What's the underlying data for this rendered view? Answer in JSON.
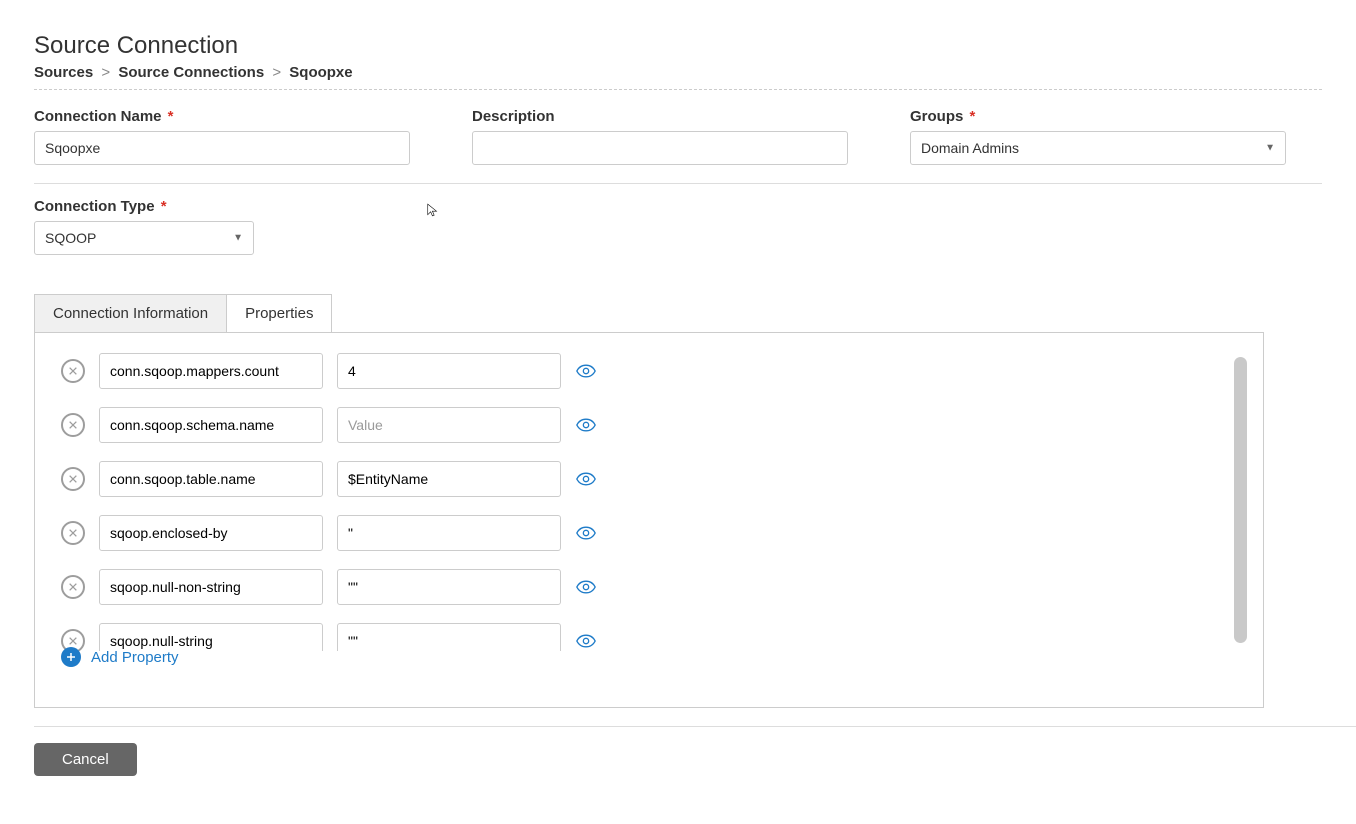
{
  "page_title": "Source Connection",
  "breadcrumb": {
    "items": [
      "Sources",
      "Source Connections",
      "Sqoopxe"
    ]
  },
  "fields": {
    "connection_name_label": "Connection Name",
    "connection_name_value": "Sqoopxe",
    "description_label": "Description",
    "description_value": "",
    "groups_label": "Groups",
    "groups_value": "Domain Admins",
    "connection_type_label": "Connection Type",
    "connection_type_value": "SQOOP"
  },
  "tabs": {
    "conn_info": "Connection Information",
    "properties": "Properties"
  },
  "active_tab": "properties",
  "properties_value_placeholder": "Value",
  "properties": [
    {
      "key": "conn.sqoop.mappers.count",
      "value": "4"
    },
    {
      "key": "conn.sqoop.schema.name",
      "value": ""
    },
    {
      "key": "conn.sqoop.table.name",
      "value": "$EntityName"
    },
    {
      "key": "sqoop.enclosed-by",
      "value": "\""
    },
    {
      "key": "sqoop.null-non-string",
      "value": "\"\""
    },
    {
      "key": "sqoop.null-string",
      "value": "\"\""
    }
  ],
  "add_property_label": "Add Property",
  "cancel_label": "Cancel"
}
